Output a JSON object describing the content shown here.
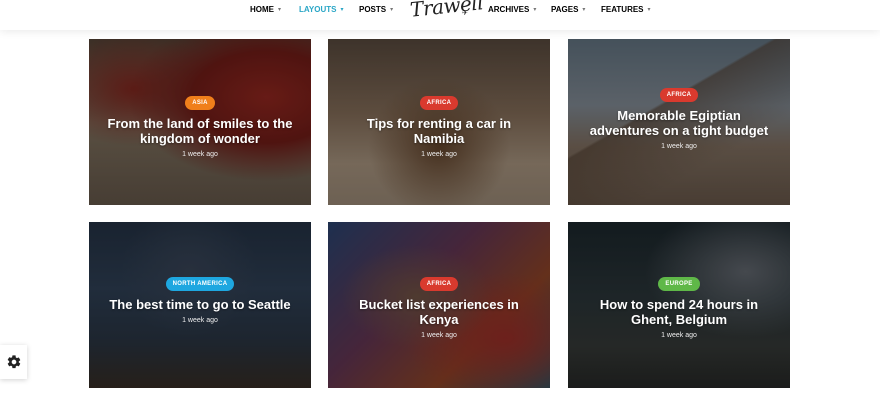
{
  "nav": {
    "items": [
      {
        "label": "HOME",
        "caret": "▾"
      },
      {
        "label": "LAYOUTS",
        "caret": "▾"
      },
      {
        "label": "POSTS",
        "caret": "▾"
      },
      {
        "label": "ARCHIVES",
        "caret": "▾"
      },
      {
        "label": "PAGES",
        "caret": "▾"
      },
      {
        "label": "FEATURES",
        "caret": "▾"
      }
    ],
    "active_index": 1,
    "logo": "Trawell",
    "logo_mark": "✈"
  },
  "cards": [
    {
      "category": "ASIA",
      "category_color": "#f07f1b",
      "title": "From the land of smiles to the kingdom of wonder",
      "meta": "1 week ago"
    },
    {
      "category": "AFRICA",
      "category_color": "#d93a2e",
      "title": "Tips for renting a car in Namibia",
      "meta": "1 week ago"
    },
    {
      "category": "AFRICA",
      "category_color": "#d93a2e",
      "title": "Memorable Egiptian adventures on a tight budget",
      "meta": "1 week ago"
    },
    {
      "category": "NORTH AMERICA",
      "category_color": "#1ea7e0",
      "title": "The best time to go to Seattle",
      "meta": "1 week ago"
    },
    {
      "category": "AFRICA",
      "category_color": "#d93a2e",
      "title": "Bucket list experiences in Kenya",
      "meta": "1 week ago"
    },
    {
      "category": "EUROPE",
      "category_color": "#5fb848",
      "title": "How to spend 24 hours in Ghent, Belgium",
      "meta": "1 week ago"
    }
  ],
  "settings_icon": "gear-icon"
}
